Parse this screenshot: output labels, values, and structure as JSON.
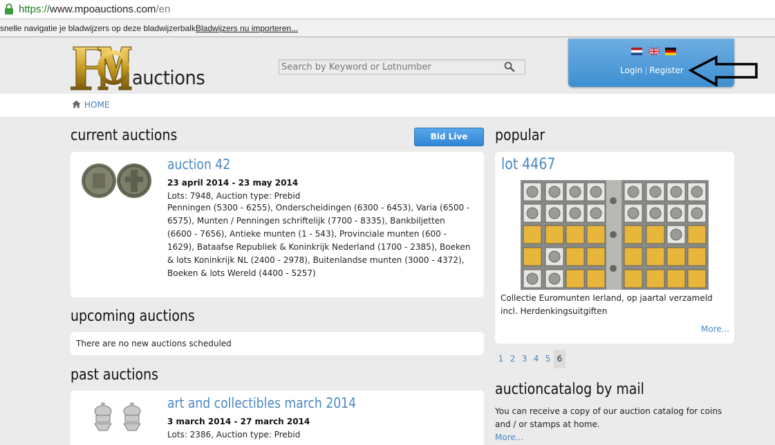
{
  "browser": {
    "url_scheme": "https://",
    "url_host": "www.mpoauctions.com",
    "url_path": "/en",
    "bookmarks_text": "snelle navigatie je bladwijzers op deze bladwijzerbalk.",
    "bookmarks_link": "Bladwijzers nu importeren..."
  },
  "header": {
    "logo_text": "auctions",
    "search_placeholder": "Search by Keyword or Lotnumber",
    "login_label": "Login",
    "separator": "|",
    "register_label": "Register",
    "flags": [
      "nl-flag",
      "uk-flag",
      "de-flag"
    ]
  },
  "breadcrumb": {
    "home_label": "HOME"
  },
  "current": {
    "heading": "current auctions",
    "bid_live_label": "Bid Live",
    "auction": {
      "title": "auction 42",
      "dates": "23 april 2014 - 23 may 2014",
      "meta": "Lots: 7948, Auction type: Prebid",
      "description": "Penningen (5300 - 6255), Onderscheidingen (6300 - 6453), Varia (6500 - 6575), Munten / Penningen schriftelijk (7700 - 8335), Bankbiljetten (6600 - 7656), Antieke munten (1 - 543), Provinciale munten (600 - 1629), Bataafse Republiek & Koninkrijk Nederland (1700 - 2385), Boeken & lots Koninkrijk NL (2400 - 2978), Buitenlandse munten (3000 - 4372), Boeken & lots Wereld (4400 - 5257)"
    }
  },
  "upcoming": {
    "heading": "upcoming auctions",
    "empty_text": "There are no new auctions scheduled"
  },
  "past": {
    "heading": "past auctions",
    "auction": {
      "title": "art and collectibles march 2014",
      "dates": "3 march 2014 - 27 march 2014",
      "meta": "Lots: 2386, Auction type: Prebid"
    }
  },
  "popular": {
    "heading": "popular",
    "lot_title": "lot 4467",
    "description": "Collectie Euromunten Ierland, op jaartal verzameld incl. Herdenkingsuitgiften",
    "more_label": "More...",
    "pages": [
      "1",
      "2",
      "3",
      "4",
      "5",
      "6"
    ],
    "active_page": "6"
  },
  "catalog": {
    "heading": "auctioncatalog by mail",
    "text": "You can receive a copy of our auction catalog for coins and / or stamps at home.",
    "more_label": "More..."
  },
  "colors": {
    "accent": "#4a87c2",
    "panel_blue": "#3d8fd1",
    "background": "#ebebeb"
  }
}
